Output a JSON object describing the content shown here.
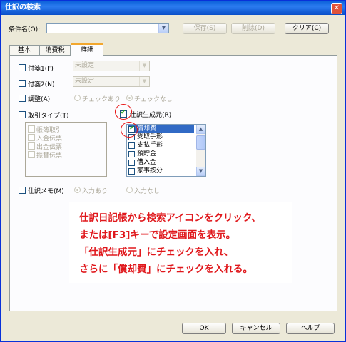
{
  "window": {
    "title": "仕訳の検索",
    "close_glyph": "✕"
  },
  "condition": {
    "label": "条件名(O):",
    "value": ""
  },
  "toolbar": {
    "save": "保存(S)",
    "delete": "削除(D)",
    "clear": "クリア(C)"
  },
  "tabs": [
    {
      "label": "基本"
    },
    {
      "label": "消費税"
    },
    {
      "label": "詳細"
    }
  ],
  "fusen1": {
    "label": "付箋1(F)",
    "value": "未設定"
  },
  "fusen2": {
    "label": "付箋2(N)",
    "value": "未設定"
  },
  "chousei": {
    "label": "調整(A)",
    "opt1": "チェックあり",
    "opt2": "チェックなし"
  },
  "torihiki": {
    "label": "取引タイプ(T)",
    "items": [
      "帳簿取引",
      "入金伝票",
      "出金伝票",
      "振替伝票"
    ]
  },
  "seiseimoto": {
    "label": "仕訳生成元(R)",
    "items": [
      "償却費",
      "受取手形",
      "支払手形",
      "預貯金",
      "借入金",
      "家事按分"
    ]
  },
  "memo": {
    "label": "仕訳メモ(M)",
    "opt1": "入力あり",
    "opt2": "入力なし"
  },
  "footer": {
    "ok": "OK",
    "cancel": "キャンセル",
    "help": "ヘルプ"
  },
  "callout": {
    "line1": "仕訳日記帳から検索アイコンをクリック、",
    "line2": "または[F3]キーで設定画面を表示。",
    "line3": "「仕訳生成元」にチェックを入れ、",
    "line4": "さらに「償却費」にチェックを入れる。"
  },
  "colors": {
    "title_bar": "#0a5fd8",
    "annotation": "#e0181c",
    "selection": "#316ac5"
  }
}
